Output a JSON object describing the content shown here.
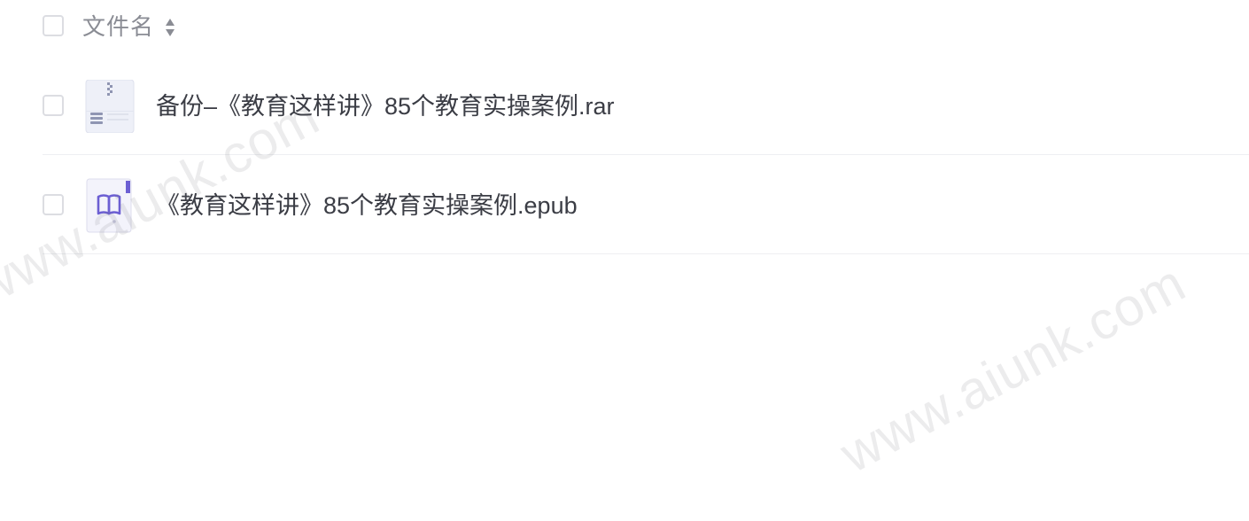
{
  "header": {
    "column_label": "文件名"
  },
  "files": [
    {
      "name": "备份–《教育这样讲》85个教育实操案例.rar",
      "icon": "archive-file-icon"
    },
    {
      "name": "《教育这样讲》85个教育实操案例.epub",
      "icon": "epub-book-icon"
    }
  ],
  "watermark": {
    "text": "www.aiunk.com"
  },
  "colors": {
    "text": "#3b3d45",
    "header_text": "#8a8c94",
    "checkbox_border": "#dcdde2",
    "divider": "#eeeff2",
    "epub_accent": "#6c5fd3"
  }
}
